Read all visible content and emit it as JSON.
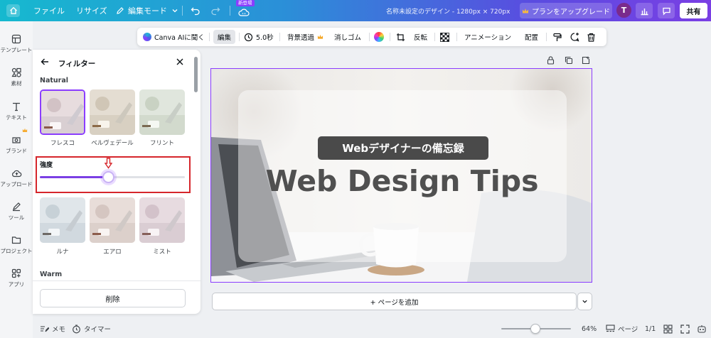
{
  "topbar": {
    "file": "ファイル",
    "resize": "リサイズ",
    "edit_mode": "編集モード",
    "new_badge": "新登場",
    "doc_title": "名称未設定のデザイン - 1280px × 720px",
    "upgrade": "プランをアップグレード",
    "avatar": "T",
    "share": "共有"
  },
  "rail": [
    {
      "label": "テンプレート"
    },
    {
      "label": "素材"
    },
    {
      "label": "テキスト"
    },
    {
      "label": "ブランド"
    },
    {
      "label": "アップロード"
    },
    {
      "label": "ツール"
    },
    {
      "label": "プロジェクト"
    },
    {
      "label": "アプリ"
    }
  ],
  "context_toolbar": {
    "canva_ai": "Canva AIに聞く",
    "edit": "編集",
    "duration": "5.0秒",
    "bg_remove": "背景透過",
    "eraser": "消しゴム",
    "flip": "反転",
    "animation": "アニメーション",
    "position": "配置"
  },
  "panel": {
    "title": "フィルター",
    "section_natural": "Natural",
    "filters_row1": [
      "フレスコ",
      "ベルヴェデール",
      "フリント"
    ],
    "intensity_label": "強度",
    "intensity_value": 0.47,
    "filters_row2": [
      "ルナ",
      "エアロ",
      "ミスト"
    ],
    "section_warm": "Warm",
    "delete": "削除"
  },
  "canvas": {
    "subtitle": "Webデザイナーの備忘録",
    "title": "Web Design Tips"
  },
  "add_page": "+ ページを追加",
  "bottombar": {
    "memo": "メモ",
    "timer": "タイマー",
    "zoom": "64%",
    "page_label": "ページ",
    "page_count": "1/1"
  },
  "colors": {
    "accent": "#8b3dff",
    "highlight": "#d6262b",
    "slider": "#7b3fe4"
  }
}
